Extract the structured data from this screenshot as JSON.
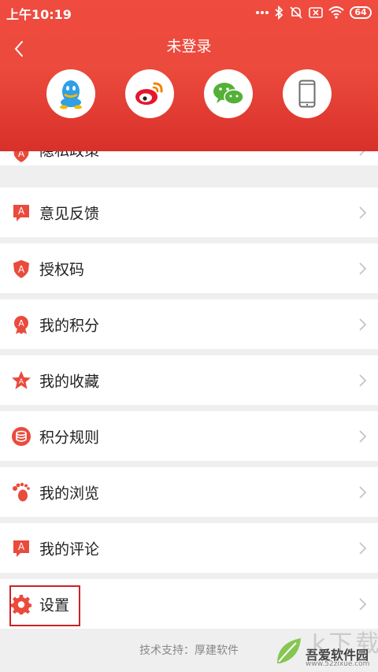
{
  "status_bar": {
    "time": "上午10:19",
    "battery": "64",
    "icons": [
      "more-dots-icon",
      "bluetooth-icon",
      "mute-icon",
      "sim-off-icon",
      "wifi-icon",
      "battery-icon"
    ]
  },
  "header": {
    "title": "未登录",
    "back_icon": "chevron-left-icon",
    "login_options": [
      {
        "name": "qq",
        "icon": "qq-icon",
        "color": "#2f9fe6"
      },
      {
        "name": "weibo",
        "icon": "weibo-icon",
        "color": "#e6162d"
      },
      {
        "name": "wechat",
        "icon": "wechat-icon",
        "color": "#52b136"
      },
      {
        "name": "phone",
        "icon": "phone-icon",
        "color": "#6c6c6c"
      }
    ]
  },
  "menu": {
    "items": [
      {
        "label": "隐私政策",
        "icon": "shield-icon"
      },
      {
        "label": "意见反馈",
        "icon": "feedback-icon"
      },
      {
        "label": "授权码",
        "icon": "shield-icon"
      },
      {
        "label": "我的积分",
        "icon": "medal-icon"
      },
      {
        "label": "我的收藏",
        "icon": "star-icon"
      },
      {
        "label": "积分规则",
        "icon": "coins-icon"
      },
      {
        "label": "我的浏览",
        "icon": "footprint-icon"
      },
      {
        "label": "我的评论",
        "icon": "comment-icon"
      },
      {
        "label": "设置",
        "icon": "gear-icon"
      }
    ]
  },
  "footer": {
    "text": "技术支持：厚建软件"
  },
  "watermark": {
    "big": "k下载",
    "title": "吾爱软件园",
    "url": "www.52zixue.com"
  },
  "colors": {
    "accent": "#e94b3c",
    "icon_red": "#e94b3c",
    "highlight_border": "#cc2226"
  }
}
